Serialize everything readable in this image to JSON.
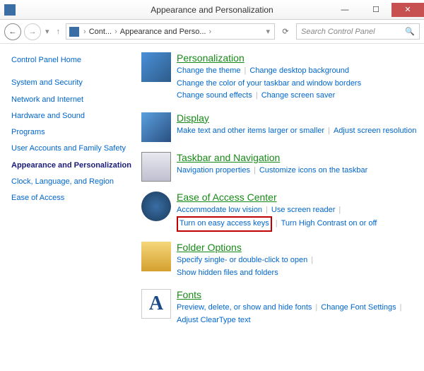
{
  "window": {
    "title": "Appearance and Personalization"
  },
  "breadcrumb": {
    "root_icon": "control-panel",
    "seg1": "Cont...",
    "seg2": "Appearance and Perso..."
  },
  "search": {
    "placeholder": "Search Control Panel"
  },
  "sidebar": {
    "home": "Control Panel Home",
    "items": [
      "System and Security",
      "Network and Internet",
      "Hardware and Sound",
      "Programs",
      "User Accounts and Family Safety",
      "Appearance and Personalization",
      "Clock, Language, and Region",
      "Ease of Access"
    ]
  },
  "sections": [
    {
      "title": "Personalization",
      "links": [
        "Change the theme",
        "Change desktop background",
        "Change the color of your taskbar and window borders",
        "Change sound effects",
        "Change screen saver"
      ]
    },
    {
      "title": "Display",
      "links": [
        "Make text and other items larger or smaller",
        "Adjust screen resolution"
      ]
    },
    {
      "title": "Taskbar and Navigation",
      "links": [
        "Navigation properties",
        "Customize icons on the taskbar"
      ]
    },
    {
      "title": "Ease of Access Center",
      "links": [
        "Accommodate low vision",
        "Use screen reader",
        "Turn on easy access keys",
        "Turn High Contrast on or off"
      ]
    },
    {
      "title": "Folder Options",
      "links": [
        "Specify single- or double-click to open",
        "Show hidden files and folders"
      ]
    },
    {
      "title": "Fonts",
      "links": [
        "Preview, delete, or show and hide fonts",
        "Change Font Settings",
        "Adjust ClearType text"
      ]
    }
  ],
  "fonts_glyph": "A"
}
